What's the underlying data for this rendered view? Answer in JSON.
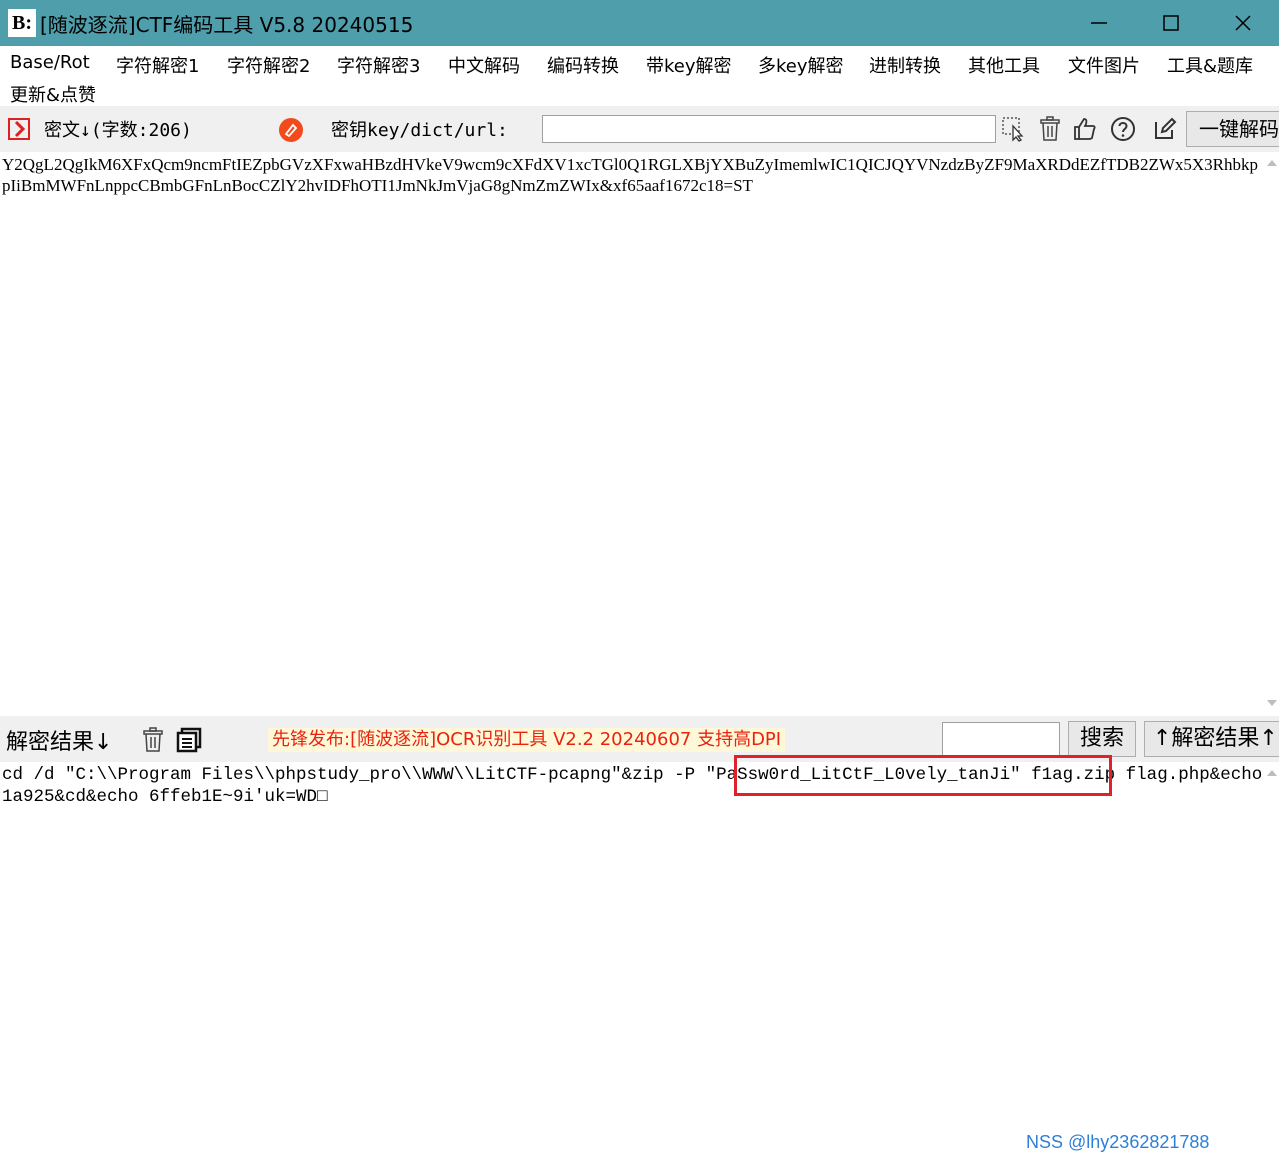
{
  "window": {
    "title": "[随波逐流]CTF编码工具 V5.8 20240515",
    "logo_text": "B:",
    "accent_color": "#4f9eab"
  },
  "menu": {
    "items": [
      "Base/Rot",
      "字符解密1",
      "字符解密2",
      "字符解密3",
      "中文解码",
      "编码转换",
      "带key解密",
      "多key解密",
      "进制转换",
      "其他工具",
      "文件图片",
      "工具&题库",
      "更新&点赞"
    ]
  },
  "cipher_toolbar": {
    "cipher_label": "密文↓(字数:206)",
    "key_label": "密钥key/dict/url:",
    "key_value": "",
    "one_key_button": "一键解码",
    "icons": [
      "import-icon",
      "eraser-icon",
      "pointer-select-icon",
      "trash-icon",
      "thumbs-up-icon",
      "help-icon",
      "edit-icon"
    ]
  },
  "cipher": {
    "text": "Y2QgL2QgIkM6XFxQcm9ncmFtIEZpbGVzXFxwaHBzdHVkeV9wcm9cXFdXV1xcTGl0Q1RGLXBjYXBuZyImemlwIC1QICJQYVNzdzByZF9MaXRDdEZfTDB2ZWx5X3RhbkppIiBmMWFnLnppcCBmbGFnLnBocCZlY2hvIDFhOTI1JmNkJmVjaG8gNmZmZWIx&xf65aaf1672c18=ST"
  },
  "result_toolbar": {
    "result_label": "解密结果↓",
    "announcement": "先锋发布:[随波逐流]OCR识别工具 V2.2 20240607 支持高DPI",
    "search_value": "",
    "search_button": "搜索",
    "up_result_button": "↑解密结果↑",
    "icons": [
      "trash-icon",
      "copy-icon"
    ]
  },
  "result": {
    "text": "cd /d \"C:\\\\Program Files\\\\phpstudy_pro\\\\WWW\\\\LitCTF-pcapng\"&zip -P \"PaSsw0rd_LitCtF_L0vely_tanJi\" f1ag.zip flag.php&echo 1a925&cd&echo 6ffeb1E~9i'uk=WD□"
  },
  "watermark": "NSS @lhy2362821788"
}
